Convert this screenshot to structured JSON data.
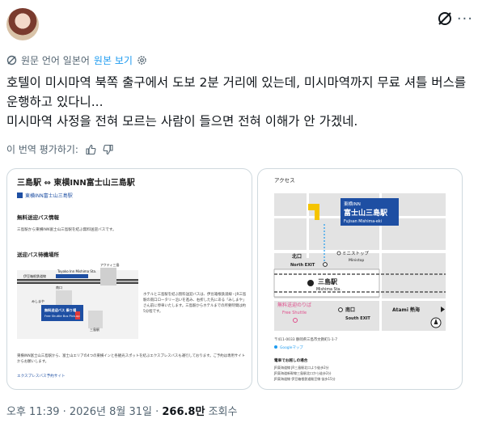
{
  "translation": {
    "label": "원문 언어 일본어",
    "link": "원본 보기"
  },
  "post": {
    "text": "호텔이 미시마역 북쪽 출구에서 도보 2분 거리에 있는데, 미시마역까지 무료 셔틀 버스를 운행하고 있다니...\n미시마역 사정을 전혀 모르는 사람이 들으면 전혀 이해가 안 가겠네."
  },
  "rate": {
    "label": "이 번역 평가하기:"
  },
  "left_card": {
    "title": "三島駅 ⇔ 東横INN富士山三島駅",
    "store": "東横INN富士山三島駅",
    "section1": "無料送迎バス情報",
    "section1_text": "三島駅から東横INN富士山三島駅を結ぶ無料送迎バスです。",
    "section2": "送迎バス待機場所",
    "map_labels": {
      "line": "伊豆箱根鉄道線",
      "inn": "Toyoko Inn Mishima Sta.",
      "act": "アクティ三島",
      "exit": "南口",
      "pole": "みしまや",
      "bus": "無料送迎バス 乗り場",
      "bus_en": "Free Shuttle Bus Pick-up",
      "station": "三島駅"
    },
    "info": "ホテルと三島駅を結ぶ無料送迎バスは、伊豆箱根鉄道線・JR三島駅の南口ロータリー沿いを進み、右折した先にある「みしまや」さん前に停車いたします。三島駅からホテルまでの所要時間は約5分程です。",
    "bottom": "東横INN富士山三島駅から、富士山エリアの4つの東横インと各観光スポットを結ぶエクスプレスバスも運行しております。ご予約は専用サイトからお願いします。",
    "bottom_link": "エクスプレスバス予約サイト"
  },
  "right_card": {
    "access": "アクセス",
    "hotel_small": "東横INN",
    "hotel_big": "富士山三島駅",
    "hotel_en": "Fujisan Mishima-eki",
    "north": "北口",
    "north_en": "North EXIT",
    "ministop": "ミニストップ",
    "ministop_en": "Ministop",
    "station": "三島駅",
    "station_en": "Mishima Sta.",
    "shuttle": "無料送迎のりば",
    "shuttle_en": "Free Shuttle",
    "south": "南口",
    "south_en": "South EXIT",
    "atami": "Atami 熱海",
    "address": "〒411-0033 静岡県三島市文教町1-1-7",
    "gmap": "Googleマップ",
    "route": "電車でお越しの場合",
    "route1": "JR東海道線 JR三島駅北口より徒歩2分",
    "route2": "JR東海道新幹線三島駅北口から徒歩2分",
    "route3": "JR東海道線 伊豆箱根鉄道駿豆線 徒歩15分"
  },
  "footer": {
    "time": "오후 11:39 · 2026년 8월 31일 · ",
    "views": "266.8만",
    "views_label": " 조회수"
  },
  "colors": {
    "link": "#1d9bf0",
    "muted": "#536471",
    "toyoko_blue": "#1e4fa3",
    "yellow": "#f5c400",
    "pink": "#e04d8b"
  }
}
